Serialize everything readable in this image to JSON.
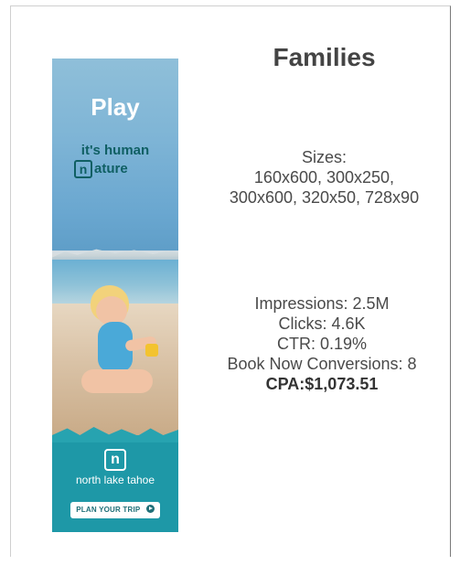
{
  "card": {
    "title": "Families",
    "sizes_label": "Sizes:",
    "sizes_line1": "160x600, 300x250,",
    "sizes_line2": "300x600, 320x50, 728x90",
    "stats": {
      "impressions": "Impressions: 2.5M",
      "clicks": "Clicks: 4.6K",
      "ctr": "CTR: 0.19%",
      "conversions": "Book Now Conversions: 8",
      "cpa": "CPA:$1,073.51"
    }
  },
  "ad": {
    "headline": "Play",
    "subhead1": "it's human",
    "subhead2_letter": "n",
    "subhead2_rest": "ature",
    "logo_letter": "n",
    "logo_text": "north lake tahoe",
    "cta_label": "PLAN YOUR TRIP",
    "cta_icon": "play-circle-icon",
    "colors": {
      "teal": "#1e98a7",
      "text_dark_teal": "#0f5f63"
    }
  }
}
